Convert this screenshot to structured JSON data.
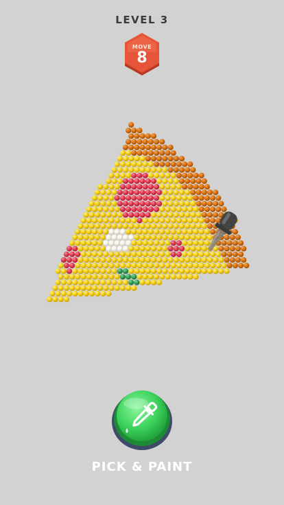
{
  "header": {
    "level": "LEVEL 3"
  },
  "moves": {
    "label": "MOVE",
    "count": "8"
  },
  "action_button": {
    "label": "PICK & PAINT"
  },
  "colors": {
    "background": "#d2d2d2",
    "cheese_yellow": "#f4cf14",
    "crust_orange": "#d7700f",
    "pepperoni_red": "#e03a50",
    "onion_white": "#f4f1e6",
    "pepper_green": "#2f9d55",
    "badge_red": "#e6553a",
    "button_green": "#3fd45e",
    "dropper_gray": "#555555"
  }
}
